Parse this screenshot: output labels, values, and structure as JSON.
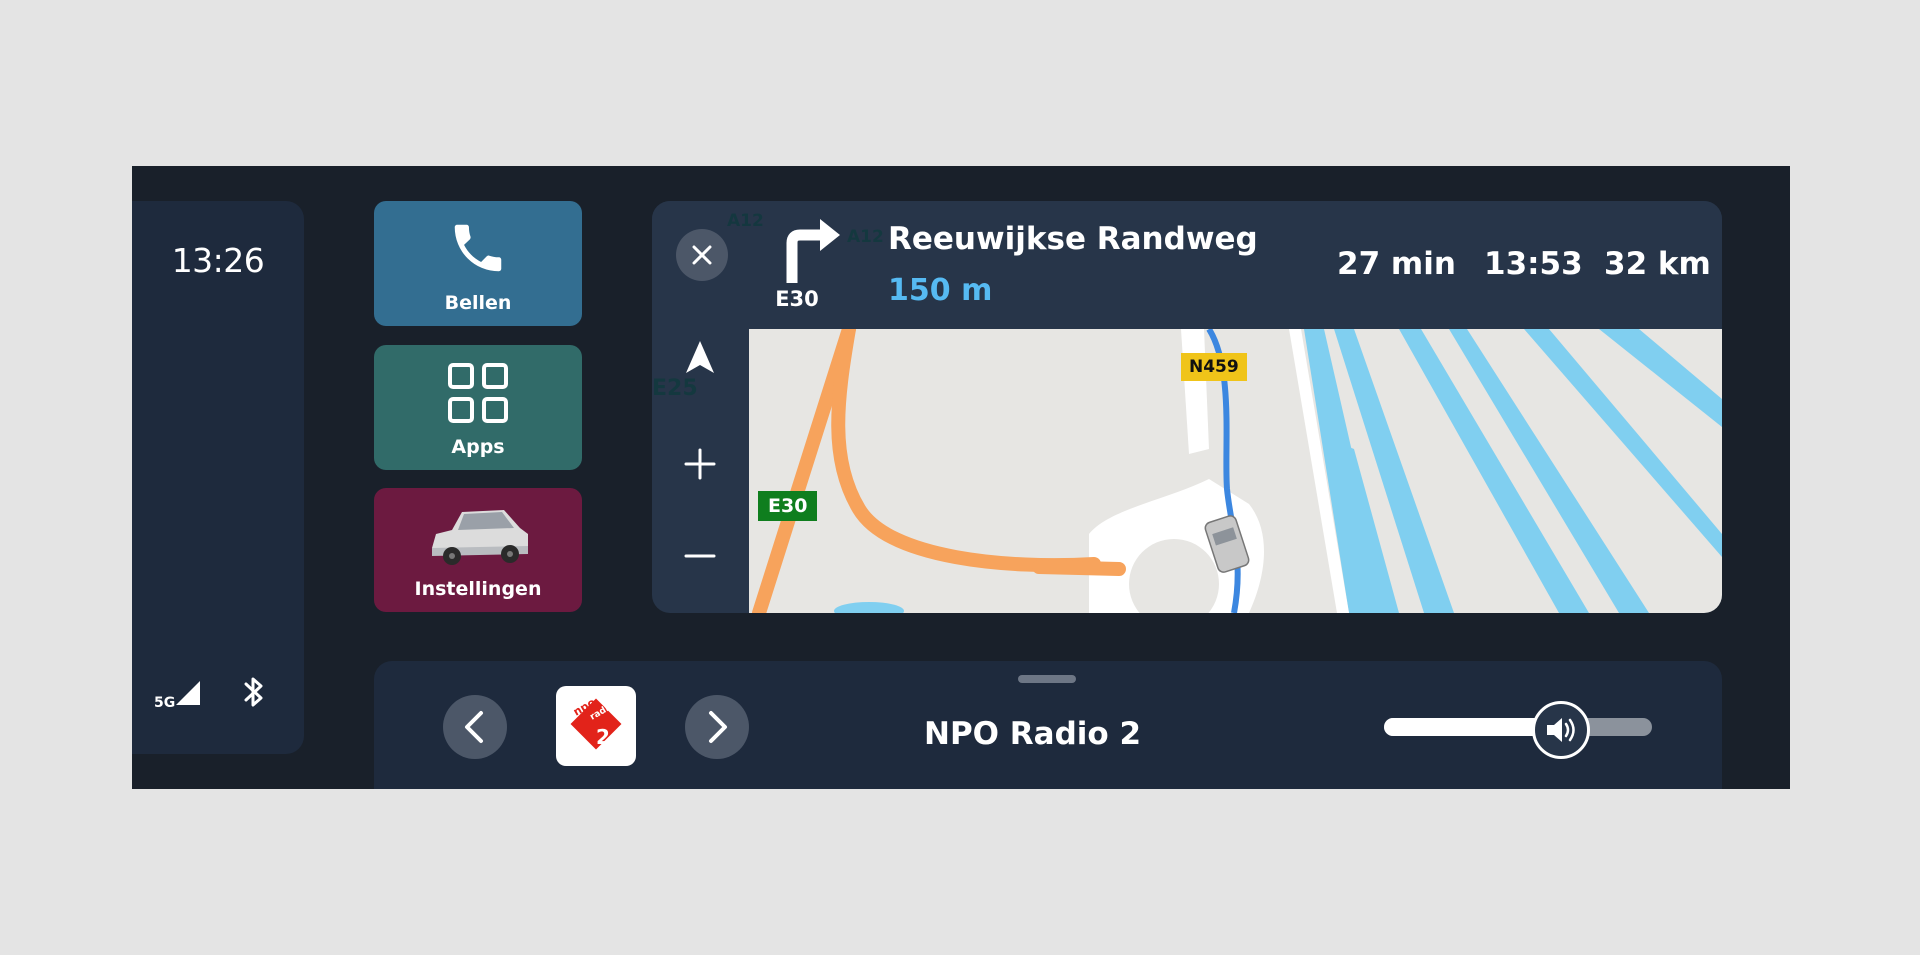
{
  "status": {
    "time": "13:26",
    "network": "5G",
    "icons": [
      "signal-icon",
      "bluetooth-icon"
    ]
  },
  "shortcuts": [
    {
      "label": "Bellen",
      "icon": "phone-icon",
      "color": "#336e91"
    },
    {
      "label": "Apps",
      "icon": "apps-grid-icon",
      "color": "#316b69"
    },
    {
      "label": "Instellingen",
      "icon": "car-icon",
      "color": "#6c1a40"
    }
  ],
  "navigation": {
    "maneuver_icon": "turn-right-icon",
    "maneuver_road": "E30",
    "street": "Reeuwijkse Randweg",
    "distance": "150 m",
    "duration": "27 min",
    "arrival": "13:53",
    "remaining": "32 km",
    "map_labels": {
      "road_e30": "E30",
      "road_n459": "N459",
      "ghost_a12a": "A12",
      "ghost_a12b": "A12",
      "ghost_e25": "E25"
    },
    "controls": [
      "close-icon",
      "recenter-icon",
      "zoom-in-icon",
      "zoom-out-icon"
    ]
  },
  "media": {
    "station": "NPO Radio 2",
    "logo_text_top": "npo",
    "logo_text_mid": "radio",
    "logo_text_num": "2",
    "volume": 0.66
  }
}
